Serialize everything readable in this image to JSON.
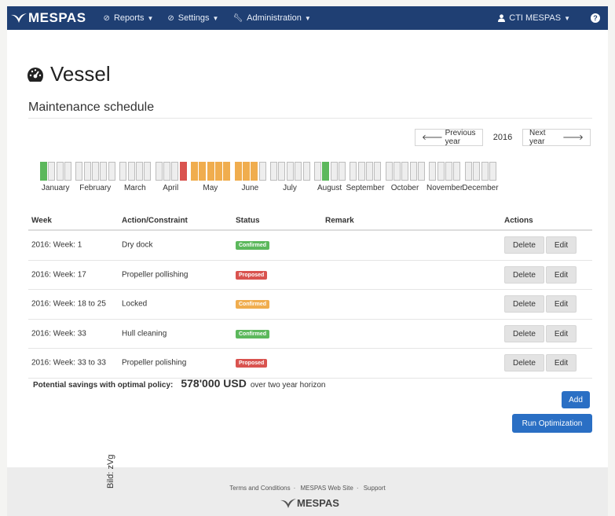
{
  "navbar": {
    "brand": "MESPAS",
    "menus": [
      {
        "label": "Reports",
        "icon": "dashboard-icon"
      },
      {
        "label": "Settings",
        "icon": "dashboard-icon"
      },
      {
        "label": "Administration",
        "icon": "wrench-icon"
      }
    ],
    "user": "CTI MESPAS",
    "help_label": "?"
  },
  "page": {
    "title": "Vessel",
    "title_icon": "dashboard-icon",
    "subtitle": "Maintenance schedule"
  },
  "year_nav": {
    "prev_label": "Previous year",
    "year": "2016",
    "next_label": "Next year"
  },
  "calendar": {
    "months": [
      "January",
      "February",
      "March",
      "April",
      "May",
      "June",
      "July",
      "August",
      "September",
      "October",
      "November",
      "December"
    ],
    "colors": {
      "empty": "#eeeeee",
      "green": "#5cb85c",
      "red": "#d9534f",
      "orange": "#f0ad4e"
    },
    "weeks": [
      "green",
      "empty",
      "empty",
      "empty",
      "empty",
      "empty",
      "empty",
      "empty",
      "empty",
      "empty",
      "empty",
      "empty",
      "empty",
      "empty",
      "empty",
      "empty",
      "red",
      "orange",
      "orange",
      "orange",
      "orange",
      "orange",
      "orange",
      "orange",
      "orange",
      "empty",
      "empty",
      "empty",
      "empty",
      "empty",
      "empty",
      "empty",
      "green",
      "empty",
      "empty",
      "empty",
      "empty",
      "empty",
      "empty",
      "empty",
      "empty",
      "empty",
      "empty",
      "empty",
      "empty",
      "empty",
      "empty",
      "empty",
      "empty",
      "empty",
      "empty",
      "empty"
    ]
  },
  "table": {
    "headers": [
      "Week",
      "Action/Constraint",
      "Status",
      "Remark",
      "Actions"
    ],
    "rows": [
      {
        "week": "2016: Week: 1",
        "action": "Dry dock",
        "status": "Confirmed",
        "status_color": "#5cb85c",
        "remark": ""
      },
      {
        "week": "2016: Week: 17",
        "action": "Propeller pollishing",
        "status": "Proposed",
        "status_color": "#d9534f",
        "remark": ""
      },
      {
        "week": "2016: Week: 18 to 25",
        "action": "Locked",
        "status": "Confirmed",
        "status_color": "#f0ad4e",
        "remark": ""
      },
      {
        "week": "2016: Week: 33",
        "action": "Hull cleaning",
        "status": "Confirmed",
        "status_color": "#5cb85c",
        "remark": ""
      },
      {
        "week": "2016: Week: 33 to 33",
        "action": "Propeller polishing",
        "status": "Proposed",
        "status_color": "#d9534f",
        "remark": ""
      }
    ],
    "delete_label": "Delete",
    "edit_label": "Edit"
  },
  "savings": {
    "label": "Potential savings with optimal policy:",
    "amount": "578'000 USD",
    "suffix": "over two year horizon"
  },
  "buttons": {
    "add": "Add",
    "run": "Run Optimization"
  },
  "footer": {
    "links": [
      "Terms and Conditions",
      "MESPAS Web Site",
      "Support"
    ],
    "brand": "MESPAS"
  },
  "credit": "Bild: zVg",
  "colors": {
    "navbar": "#1f3f73",
    "primary": "#2a6fc4"
  }
}
